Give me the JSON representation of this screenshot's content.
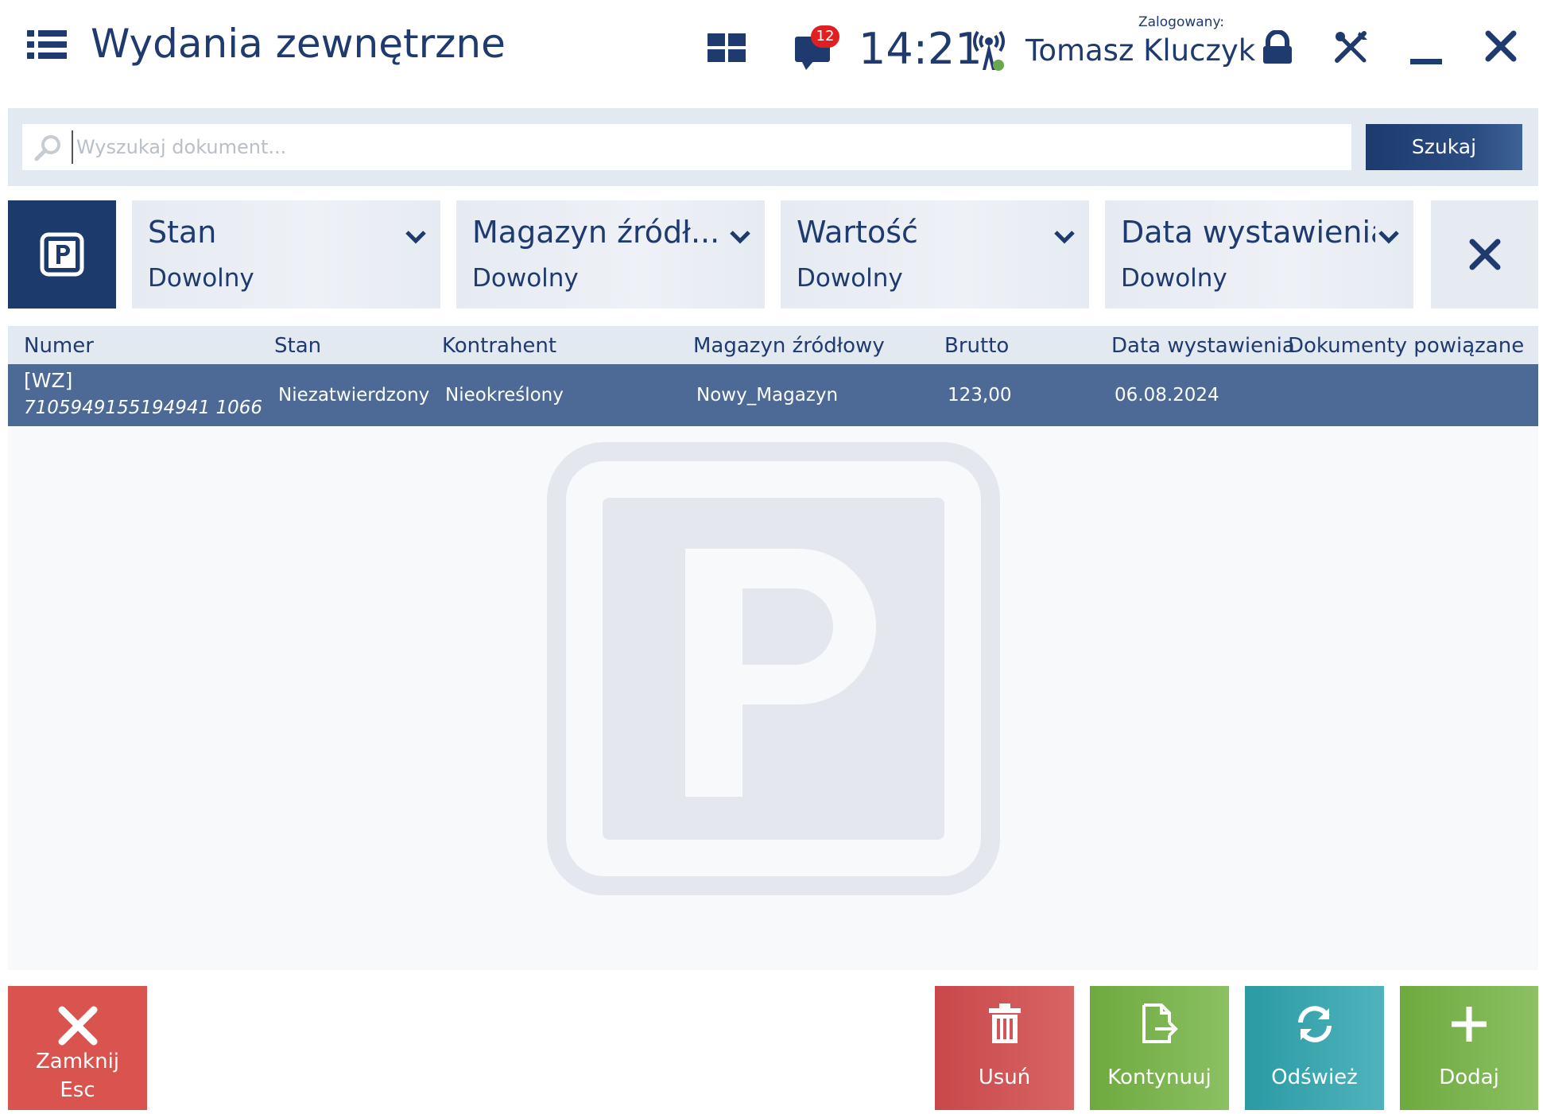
{
  "header": {
    "title": "Wydania zewnętrzne",
    "notifications_count": "12",
    "time": "14:21",
    "logged_label": "Zalogowany:",
    "user_name": "Tomasz Kluczyk"
  },
  "search": {
    "placeholder": "Wyszukaj dokument...",
    "value": "",
    "button_label": "Szukaj"
  },
  "filters": [
    {
      "label": "Stan",
      "value": "Dowolny"
    },
    {
      "label": "Magazyn źródł...",
      "value": "Dowolny"
    },
    {
      "label": "Wartość",
      "value": "Dowolny"
    },
    {
      "label": "Data wystawienia",
      "value": "Dowolny"
    }
  ],
  "table": {
    "columns": [
      "Numer",
      "Stan",
      "Kontrahent",
      "Magazyn źródłowy",
      "Brutto",
      "Data wystawienia",
      "Dokumenty powiązane"
    ],
    "rows": [
      {
        "type": "[WZ]",
        "number": "7105949155194941 1066",
        "state": "Niezatwierdzony",
        "contractor": "Nieokreślony",
        "warehouse": "Nowy_Magazyn",
        "gross": "123,00",
        "date": "06.08.2024",
        "related": ""
      }
    ]
  },
  "buttons": {
    "close_label": "Zamknij",
    "close_shortcut": "Esc",
    "delete_label": "Usuń",
    "continue_label": "Kontynuuj",
    "refresh_label": "Odśwież",
    "add_label": "Dodaj"
  },
  "colors": {
    "primary": "#1d3a6d",
    "selected_row": "#4d6a96",
    "close": "#d9534f",
    "delete": "#d0555a",
    "continue": "#7db350",
    "refresh": "#3aa6af",
    "add": "#7db350",
    "badge": "#e02020"
  },
  "icons": [
    "menu-icon",
    "tiles-icon",
    "message-icon",
    "signal-icon",
    "lock-icon",
    "tools-icon",
    "minimize-icon",
    "close-icon",
    "search-icon",
    "parking-icon",
    "chevron-down-icon",
    "trash-icon",
    "document-export-icon",
    "refresh-icon",
    "plus-icon"
  ]
}
